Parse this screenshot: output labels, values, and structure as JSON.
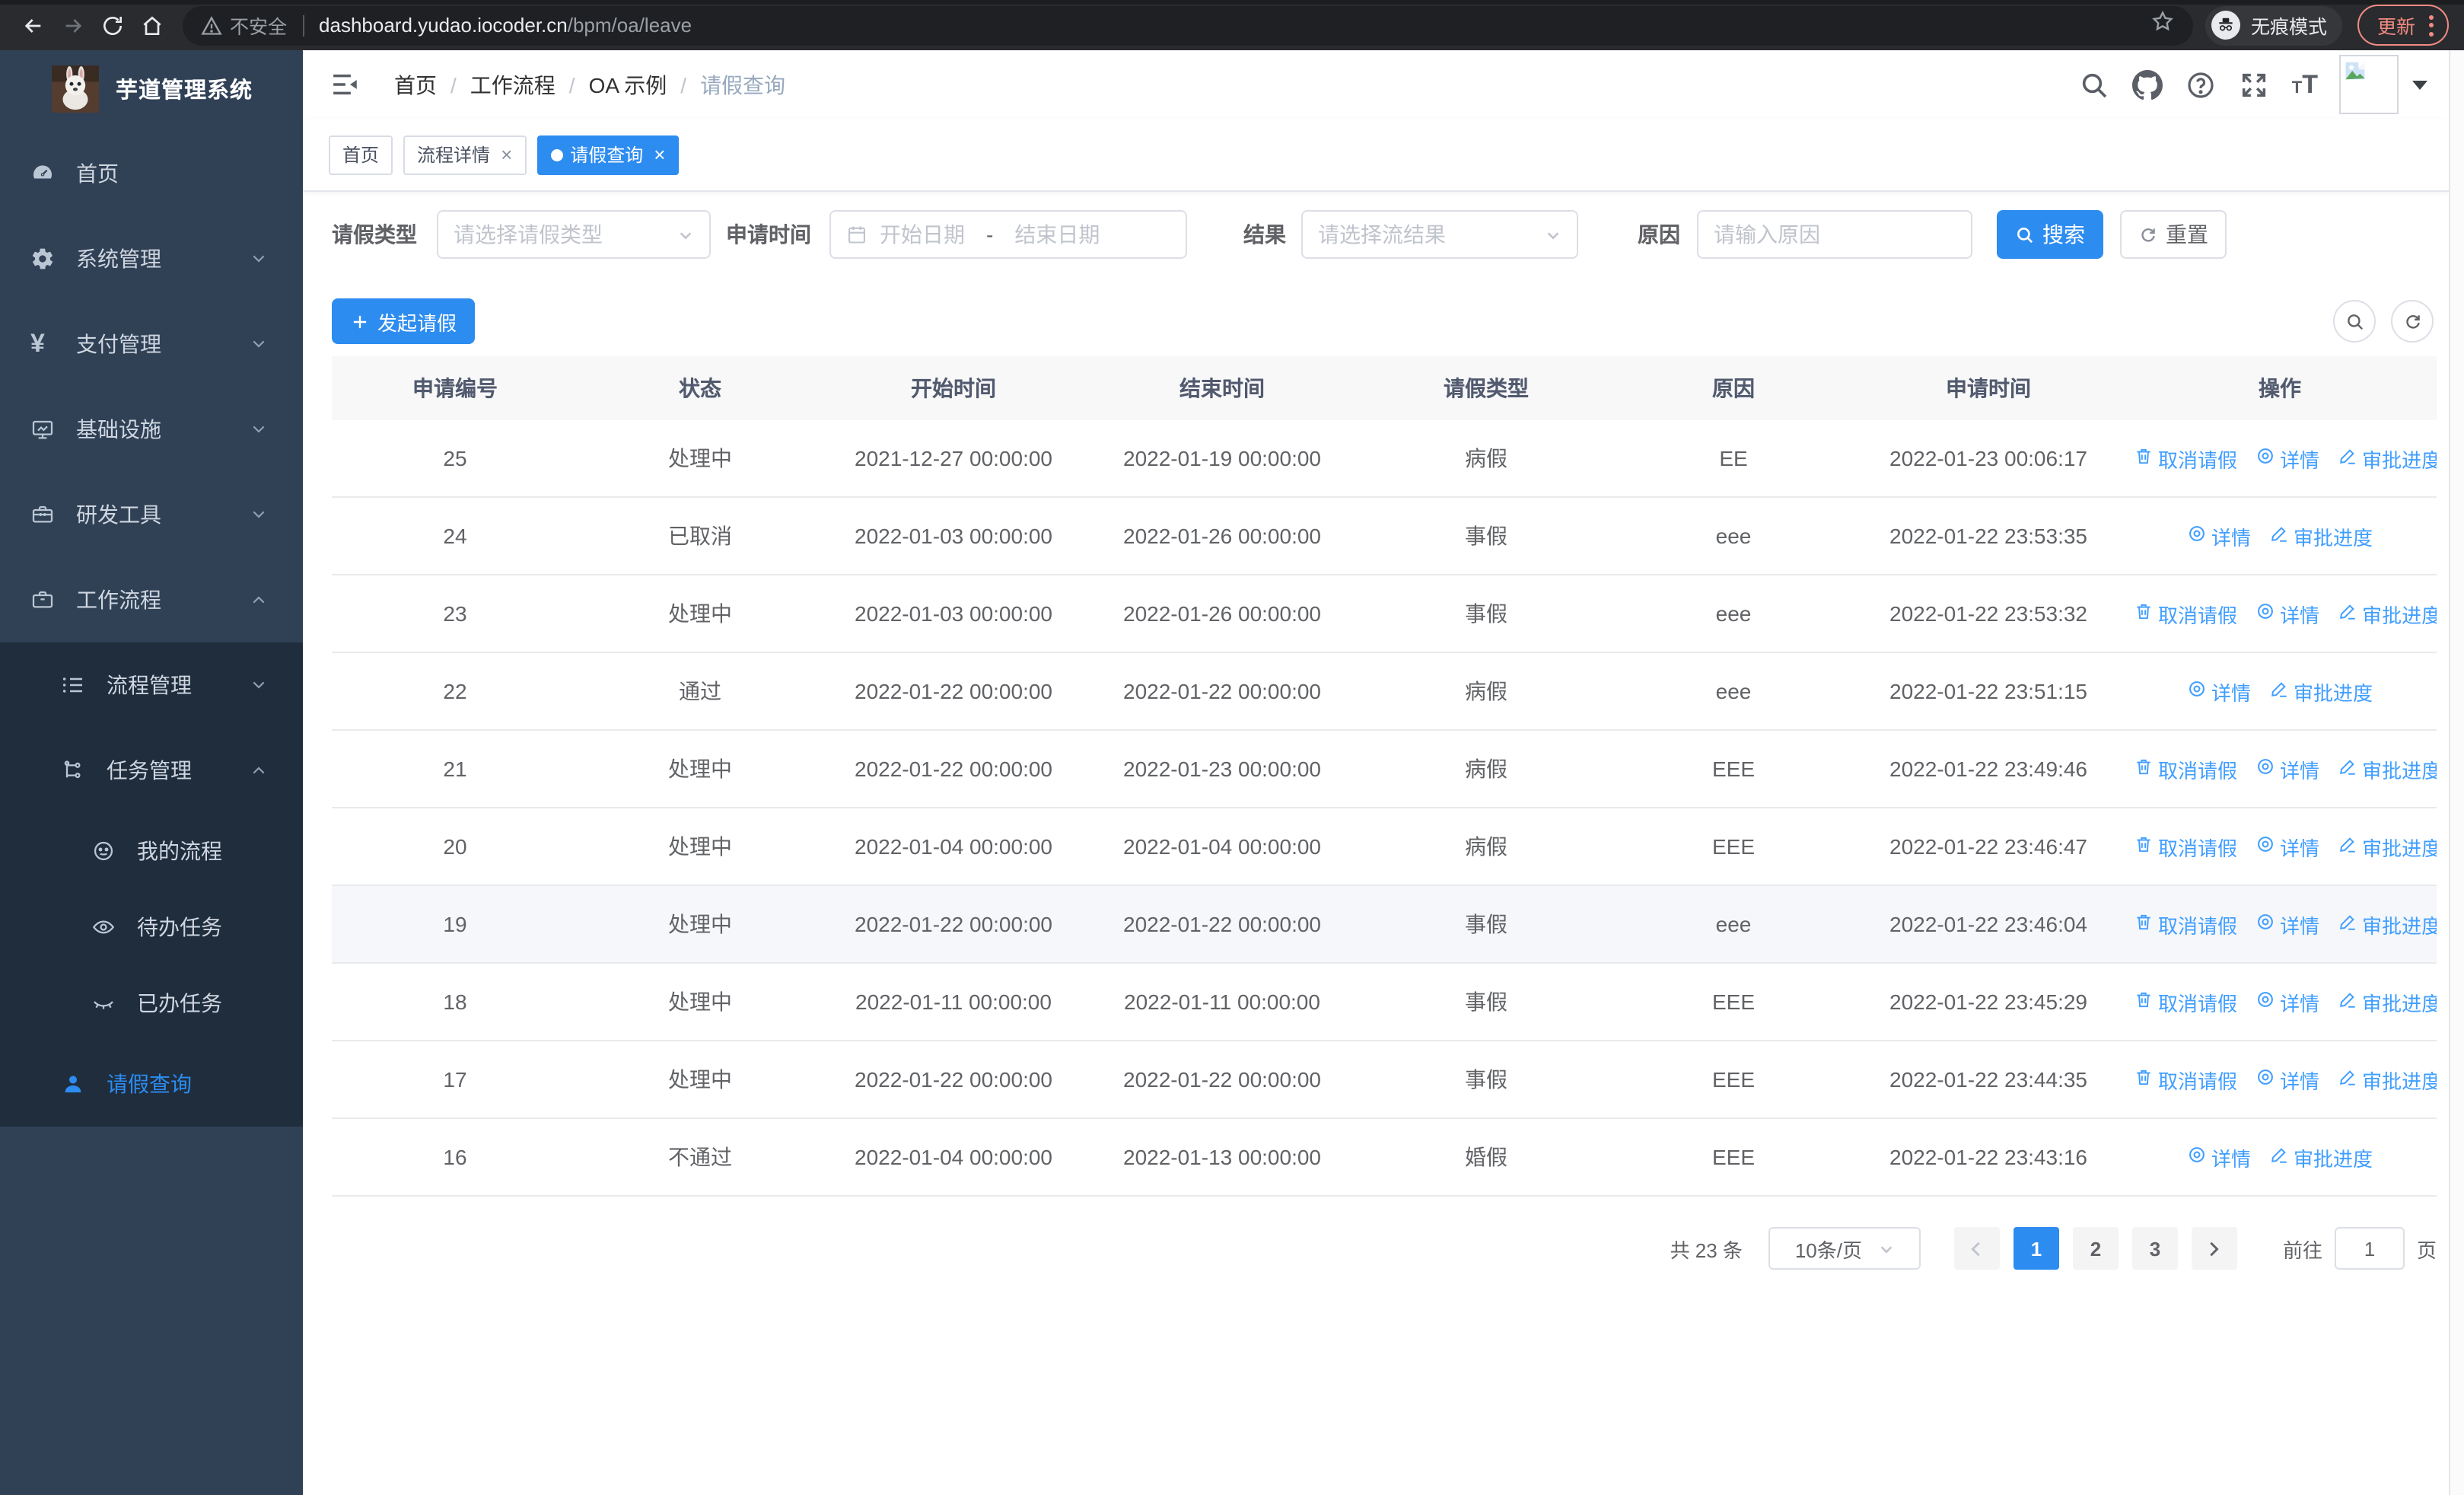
{
  "browser": {
    "secure_label": "不安全",
    "url_host": "dashboard.yudao.iocoder.cn",
    "url_path": "/bpm/oa/leave",
    "incognito_label": "无痕模式",
    "update_label": "更新"
  },
  "colors": {
    "accent": "#2d8cf0",
    "link": "#409eff",
    "sidebar_bg": "#304156",
    "submenu_bg": "#1f2d3d",
    "update_pill": "#f28b82"
  },
  "sidebar": {
    "title": "芋道管理系统",
    "items": [
      {
        "name": "home",
        "label": "首页",
        "icon": "gauge",
        "level": 1
      },
      {
        "name": "system-management",
        "label": "系统管理",
        "icon": "gear",
        "level": 1,
        "chevron": "down"
      },
      {
        "name": "payment-management",
        "label": "支付管理",
        "icon": "yen",
        "level": 1,
        "chevron": "down"
      },
      {
        "name": "infrastructure",
        "label": "基础设施",
        "icon": "monitor",
        "level": 1,
        "chevron": "down"
      },
      {
        "name": "dev-tools",
        "label": "研发工具",
        "icon": "toolbox",
        "level": 1,
        "chevron": "down"
      },
      {
        "name": "workflow",
        "label": "工作流程",
        "icon": "briefcase",
        "level": 1,
        "chevron": "up"
      }
    ],
    "submenu": [
      {
        "name": "process-management",
        "label": "流程管理",
        "icon": "list-tree",
        "level": 2,
        "chevron": "down"
      },
      {
        "name": "task-management",
        "label": "任务管理",
        "icon": "flow",
        "level": 2,
        "chevron": "up"
      },
      {
        "name": "my-process",
        "label": "我的流程",
        "icon": "face",
        "level": 3
      },
      {
        "name": "todo-tasks",
        "label": "待办任务",
        "icon": "eye-open",
        "level": 3
      },
      {
        "name": "done-tasks",
        "label": "已办任务",
        "icon": "eye-closed",
        "level": 3
      },
      {
        "name": "leave-query",
        "label": "请假查询",
        "icon": "person",
        "level": 2,
        "active": true
      }
    ]
  },
  "header": {
    "breadcrumb": [
      "首页",
      "工作流程",
      "OA 示例",
      "请假查询"
    ]
  },
  "tabs": [
    {
      "name": "home",
      "label": "首页"
    },
    {
      "name": "process-detail",
      "label": "流程详情",
      "closable": true
    },
    {
      "name": "leave-query",
      "label": "请假查询",
      "closable": true,
      "active": true
    }
  ],
  "filters": {
    "leave_type_label": "请假类型",
    "leave_type_placeholder": "请选择请假类型",
    "apply_time_label": "申请时间",
    "start_date_placeholder": "开始日期",
    "range_separator": "-",
    "end_date_placeholder": "结束日期",
    "result_label": "结果",
    "result_placeholder": "请选择流结果",
    "reason_label": "原因",
    "reason_placeholder": "请输入原因",
    "search_label": "搜索",
    "reset_label": "重置"
  },
  "toolbar": {
    "create_label": "发起请假"
  },
  "table": {
    "columns": [
      "申请编号",
      "状态",
      "开始时间",
      "结束时间",
      "请假类型",
      "原因",
      "申请时间",
      "操作"
    ],
    "action_labels": {
      "cancel": "取消请假",
      "detail": "详情",
      "progress": "审批进度"
    },
    "rows": [
      {
        "id": "25",
        "status": "处理中",
        "start": "2021-12-27 00:00:00",
        "end": "2022-01-19 00:00:00",
        "type": "病假",
        "reason": "EE",
        "applied": "2022-01-23 00:06:17",
        "actions": [
          "cancel",
          "detail",
          "progress"
        ]
      },
      {
        "id": "24",
        "status": "已取消",
        "start": "2022-01-03 00:00:00",
        "end": "2022-01-26 00:00:00",
        "type": "事假",
        "reason": "eee",
        "applied": "2022-01-22 23:53:35",
        "actions": [
          "detail",
          "progress"
        ]
      },
      {
        "id": "23",
        "status": "处理中",
        "start": "2022-01-03 00:00:00",
        "end": "2022-01-26 00:00:00",
        "type": "事假",
        "reason": "eee",
        "applied": "2022-01-22 23:53:32",
        "actions": [
          "cancel",
          "detail",
          "progress"
        ]
      },
      {
        "id": "22",
        "status": "通过",
        "start": "2022-01-22 00:00:00",
        "end": "2022-01-22 00:00:00",
        "type": "病假",
        "reason": "eee",
        "applied": "2022-01-22 23:51:15",
        "actions": [
          "detail",
          "progress"
        ]
      },
      {
        "id": "21",
        "status": "处理中",
        "start": "2022-01-22 00:00:00",
        "end": "2022-01-23 00:00:00",
        "type": "病假",
        "reason": "EEE",
        "applied": "2022-01-22 23:49:46",
        "actions": [
          "cancel",
          "detail",
          "progress"
        ]
      },
      {
        "id": "20",
        "status": "处理中",
        "start": "2022-01-04 00:00:00",
        "end": "2022-01-04 00:00:00",
        "type": "病假",
        "reason": "EEE",
        "applied": "2022-01-22 23:46:47",
        "actions": [
          "cancel",
          "detail",
          "progress"
        ]
      },
      {
        "id": "19",
        "status": "处理中",
        "start": "2022-01-22 00:00:00",
        "end": "2022-01-22 00:00:00",
        "type": "事假",
        "reason": "eee",
        "applied": "2022-01-22 23:46:04",
        "actions": [
          "cancel",
          "detail",
          "progress"
        ],
        "hover": true
      },
      {
        "id": "18",
        "status": "处理中",
        "start": "2022-01-11 00:00:00",
        "end": "2022-01-11 00:00:00",
        "type": "事假",
        "reason": "EEE",
        "applied": "2022-01-22 23:45:29",
        "actions": [
          "cancel",
          "detail",
          "progress"
        ]
      },
      {
        "id": "17",
        "status": "处理中",
        "start": "2022-01-22 00:00:00",
        "end": "2022-01-22 00:00:00",
        "type": "事假",
        "reason": "EEE",
        "applied": "2022-01-22 23:44:35",
        "actions": [
          "cancel",
          "detail",
          "progress"
        ]
      },
      {
        "id": "16",
        "status": "不通过",
        "start": "2022-01-04 00:00:00",
        "end": "2022-01-13 00:00:00",
        "type": "婚假",
        "reason": "EEE",
        "applied": "2022-01-22 23:43:16",
        "actions": [
          "detail",
          "progress"
        ]
      }
    ]
  },
  "pagination": {
    "total_label": "共 23 条",
    "page_size": "10条/页",
    "pages": [
      "1",
      "2",
      "3"
    ],
    "active_page": "1",
    "goto_label": "前往",
    "goto_value": "1",
    "page_unit": "页"
  }
}
